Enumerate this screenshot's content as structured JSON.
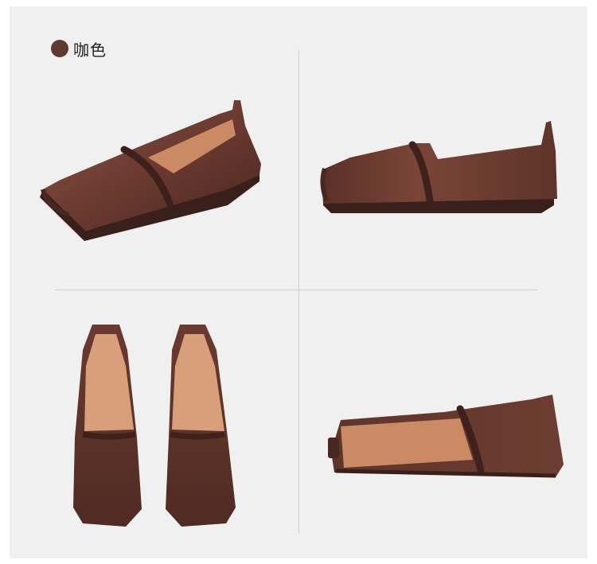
{
  "color_option": {
    "label": "咖色",
    "swatch_color": "#5e3a30"
  },
  "colors": {
    "background": "#f0f0f0",
    "leather_dark": "#4a2822",
    "leather_mid": "#6b3a30",
    "leather_light": "#8a5446",
    "lining": "#d8a07a",
    "sole": "#3a201a"
  },
  "views": [
    {
      "id": "three-quarter-view"
    },
    {
      "id": "side-view"
    },
    {
      "id": "top-view-pair"
    },
    {
      "id": "rear-inside-view"
    }
  ]
}
